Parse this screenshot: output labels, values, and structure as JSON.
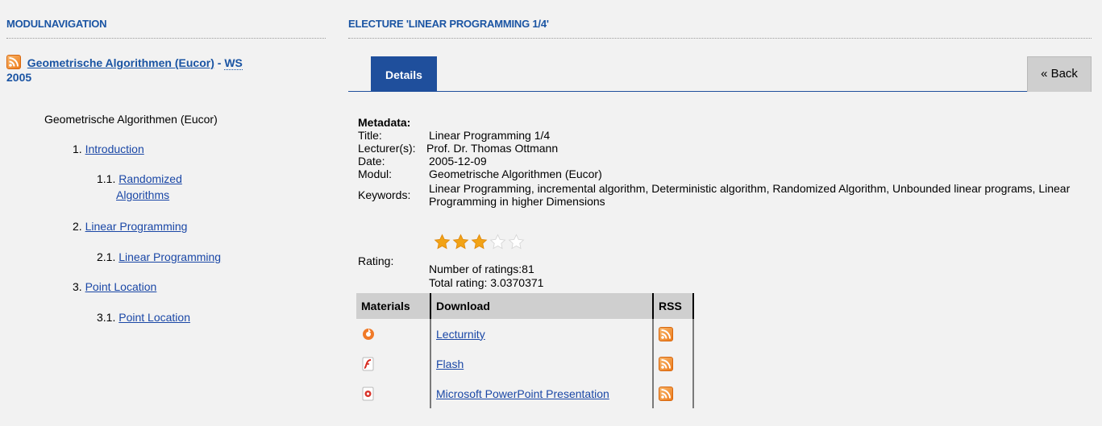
{
  "left": {
    "heading": "MODULNAVIGATION",
    "module_link": "Geometrische Algorithmen (Eucor)",
    "module_sep": " - ",
    "module_ws": "WS",
    "module_year": "2005",
    "tree_root": "Geometrische Algorithmen (Eucor)",
    "items": [
      {
        "num": "1.",
        "label": "Introduction"
      },
      {
        "num": "1.1.",
        "label": "Randomized"
      },
      {
        "num": "",
        "label": "Algorithms"
      },
      {
        "num": "2.",
        "label": "Linear Programming"
      },
      {
        "num": "2.1.",
        "label": "Linear Programming"
      },
      {
        "num": "3.",
        "label": "Point Location"
      },
      {
        "num": "3.1.",
        "label": "Point Location"
      }
    ]
  },
  "right": {
    "heading": "ELECTURE 'LINEAR PROGRAMMING 1/4'",
    "tab_details": "Details",
    "back_button": "« Back",
    "metadata_label": "Metadata:",
    "fields": {
      "title_k": "Title:",
      "title_v": "Linear Programming 1/4",
      "lecturer_k": "Lecturer(s):",
      "lecturer_v": "Prof. Dr. Thomas Ottmann",
      "date_k": "Date:",
      "date_v": "2005-12-09",
      "modul_k": "Modul:",
      "modul_v": "Geometrische Algorithmen (Eucor)",
      "keywords_k": "Keywords:",
      "keywords_v": "Linear Programming, incremental algorithm, Deterministic algorithm, Randomized Algorithm, Unbounded linear programs, Linear Programming in higher Dimensions",
      "rating_k": "Rating:",
      "rating_count": "Number of ratings:81",
      "rating_total": "Total rating: 3.0370371"
    },
    "rating_stars_filled": 3,
    "rating_stars_total": 5,
    "table": {
      "headers": [
        "Materials",
        "Download",
        "RSS"
      ],
      "rows": [
        {
          "icon": "lecturnity-icon",
          "link": "Lecturnity"
        },
        {
          "icon": "flash-icon",
          "link": "Flash"
        },
        {
          "icon": "powerpoint-icon",
          "link": "Microsoft PowerPoint Presentation"
        }
      ]
    }
  },
  "colors": {
    "heading": "#1a54a3",
    "tab": "#1f4f9c",
    "rss": "#ee7c1b",
    "star": "#f2a316"
  }
}
